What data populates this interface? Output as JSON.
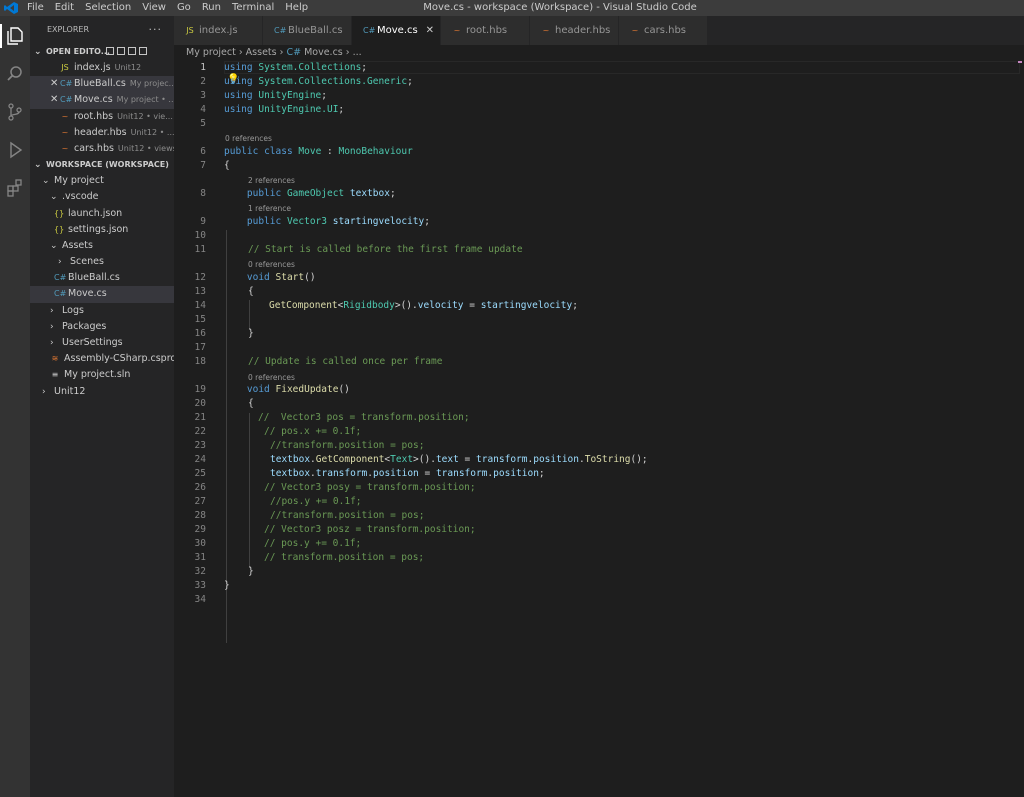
{
  "titlebar": {
    "menu": [
      "File",
      "Edit",
      "Selection",
      "View",
      "Go",
      "Run",
      "Terminal",
      "Help"
    ],
    "window_title": "Move.cs - workspace (Workspace) - Visual Studio Code"
  },
  "sidebar": {
    "header": "EXPLORER",
    "open_editors_label": "OPEN EDITO...",
    "open_editors": [
      {
        "name": "index.js",
        "desc": "Unit12",
        "icon": "JS",
        "icon_color": "#cbcb41"
      },
      {
        "name": "BlueBall.cs",
        "desc": "My projec...",
        "icon": "C#",
        "icon_color": "#519aba"
      },
      {
        "name": "Move.cs",
        "desc": "My project • ...",
        "icon": "C#",
        "icon_color": "#519aba"
      },
      {
        "name": "root.hbs",
        "desc": "Unit12 • vie...",
        "icon": "hbs",
        "icon_color": "#e37933"
      },
      {
        "name": "header.hbs",
        "desc": "Unit12 • ...",
        "icon": "hbs",
        "icon_color": "#e37933"
      },
      {
        "name": "cars.hbs",
        "desc": "Unit12 • views",
        "icon": "hbs",
        "icon_color": "#e37933"
      }
    ],
    "workspace_label": "WORKSPACE (WORKSPACE)",
    "tree": {
      "my_project": "My project",
      "vscode": ".vscode",
      "launch": "launch.json",
      "settings": "settings.json",
      "assets": "Assets",
      "scenes": "Scenes",
      "blueball": "BlueBall.cs",
      "move": "Move.cs",
      "logs": "Logs",
      "packages": "Packages",
      "usersettings": "UserSettings",
      "csproj": "Assembly-CSharp.csproj",
      "sln": "My project.sln",
      "unit12": "Unit12"
    }
  },
  "tabs": [
    {
      "label": "index.js",
      "icon": "JS",
      "icon_color": "#cbcb41",
      "active": false
    },
    {
      "label": "BlueBall.cs",
      "icon": "C#",
      "icon_color": "#519aba",
      "active": false
    },
    {
      "label": "Move.cs",
      "icon": "C#",
      "icon_color": "#519aba",
      "active": true
    },
    {
      "label": "root.hbs",
      "icon": "hbs",
      "icon_color": "#e37933",
      "active": false
    },
    {
      "label": "header.hbs",
      "icon": "hbs",
      "icon_color": "#e37933",
      "active": false
    },
    {
      "label": "cars.hbs",
      "icon": "hbs",
      "icon_color": "#e37933",
      "active": false
    }
  ],
  "breadcrumb": [
    "My project",
    "Assets",
    "Move.cs",
    "..."
  ],
  "editor": {
    "line_numbers": [
      "1",
      "2",
      "3",
      "4",
      "5",
      "6",
      "7",
      "8",
      "9",
      "10",
      "11",
      "12",
      "13",
      "14",
      "15",
      "16",
      "17",
      "18",
      "19",
      "20",
      "21",
      "22",
      "23",
      "24",
      "25",
      "26",
      "27",
      "28",
      "29",
      "30",
      "31",
      "32",
      "33",
      "34"
    ],
    "lens": {
      "class_refs": "0 references",
      "textbox_refs": "2 references",
      "velocity_refs": "1 reference",
      "start_refs": "0 references",
      "fixed_refs": "0 references"
    },
    "code": {
      "l1_kw": "using",
      "l1_ns": "System.Collections",
      "l2_kw": "using",
      "l2_ns": "System.Collections.Generic",
      "l3_kw": "using",
      "l3_ns": "UnityEngine",
      "l4_kw": "using",
      "l4_ns": "UnityEngine.UI",
      "l6_kw1": "public",
      "l6_kw2": "class",
      "l6_name": "Move",
      "l6_base": "MonoBehaviour",
      "l7": "{",
      "l8_kw": "public",
      "l8_type": "GameObject",
      "l8_var": "textbox",
      "l9_kw": "public",
      "l9_type": "Vector3",
      "l9_var": "startingvelocity",
      "l11": "// Start is called before the first frame update",
      "l12_kw": "void",
      "l12_fn": "Start",
      "l13": "{",
      "l14_fn": "GetComponent",
      "l14_type": "Rigidbody",
      "l14_var1": "velocity",
      "l14_var2": "startingvelocity",
      "l16": "}",
      "l18": "// Update is called once per frame",
      "l19_kw": "void",
      "l19_fn": "FixedUpdate",
      "l20": "{",
      "l21": "//  Vector3 pos = transform.position;",
      "l22": "// pos.x += 0.1f;",
      "l23": "//transform.position = pos;",
      "l24_v1": "textbox",
      "l24_fn1": "GetComponent",
      "l24_type": "Text",
      "l24_v2": "text",
      "l24_v3": "transform",
      "l24_v4": "position",
      "l24_fn2": "ToString",
      "l25_v1": "textbox",
      "l25_v2": "transform",
      "l25_v3": "position",
      "l25_v4": "transform",
      "l25_v5": "position",
      "l26": "// Vector3 posy = transform.position;",
      "l27": "//pos.y += 0.1f;",
      "l28": "//transform.position = pos;",
      "l29": "// Vector3 posz = transform.position;",
      "l30": "// pos.y += 0.1f;",
      "l31": "// transform.position = pos;",
      "l32": "}",
      "l33": "}"
    }
  }
}
